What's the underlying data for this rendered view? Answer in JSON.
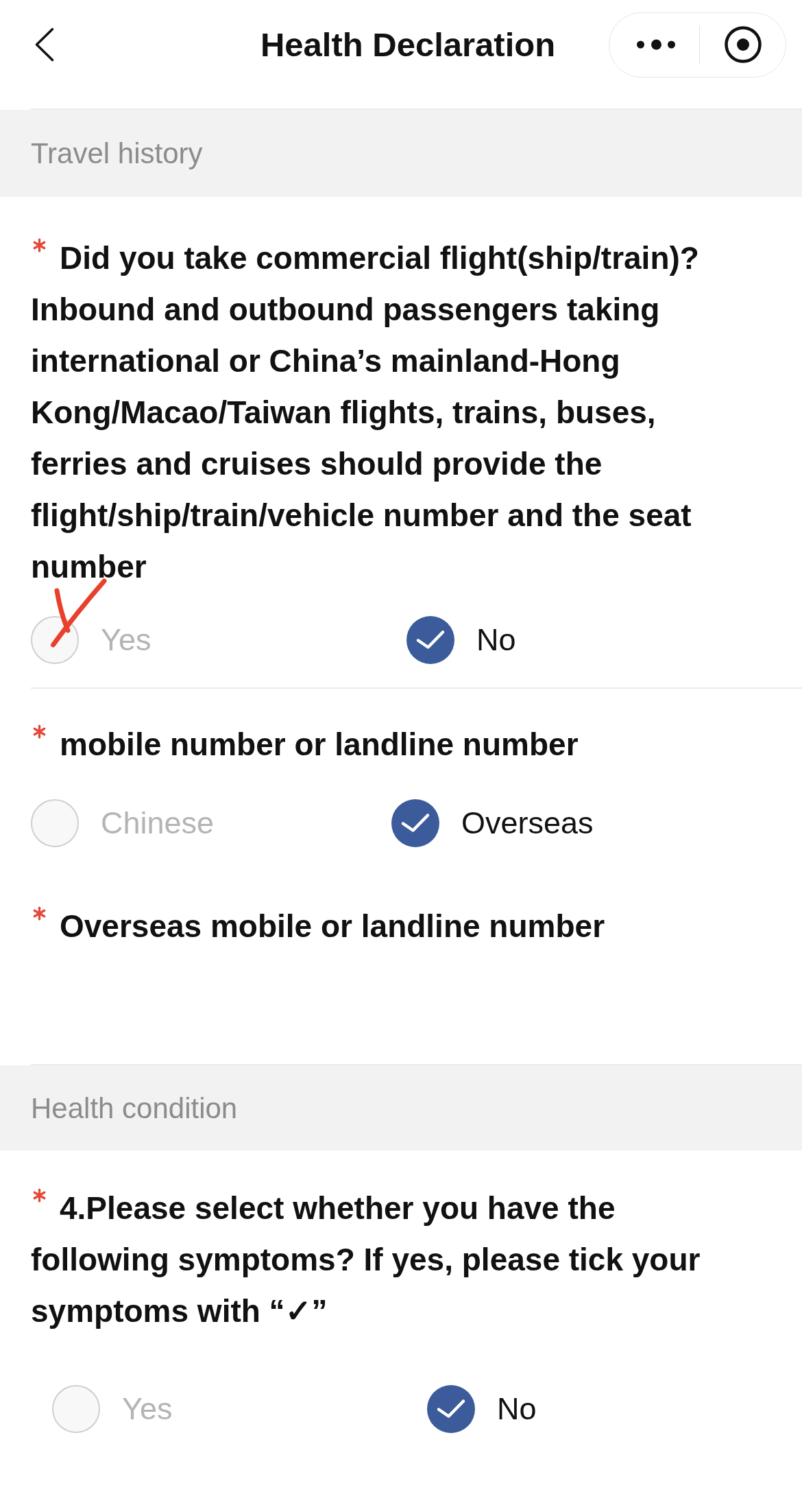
{
  "header": {
    "title": "Health Declaration"
  },
  "sections": [
    {
      "title": "Travel history",
      "questions": [
        {
          "kind": "choice",
          "required": true,
          "label": "Did you take commercial flight(ship/train)? Inbound and outbound passengers taking international or China’s mainland-Hong Kong/Macao/Taiwan flights, trains, buses, ferries and cruises should provide the flight/ship/train/vehicle number and the seat number",
          "options": [
            {
              "label": "Yes",
              "selected": false,
              "hand_ticked": true
            },
            {
              "label": "No",
              "selected": true,
              "hand_ticked": false
            }
          ]
        },
        {
          "kind": "choice",
          "required": true,
          "label": "mobile number or landline number",
          "options": [
            {
              "label": "Chinese",
              "selected": false,
              "hand_ticked": false
            },
            {
              "label": "Overseas",
              "selected": true,
              "hand_ticked": false
            }
          ]
        },
        {
          "kind": "text_input",
          "required": true,
          "label": "Overseas mobile or landline number"
        }
      ]
    },
    {
      "title": "Health condition",
      "questions": [
        {
          "kind": "choice",
          "required": true,
          "label": "4.Please select whether you have the following symptoms? If yes, please tick your symptoms with “✓”",
          "options": [
            {
              "label": "Yes",
              "selected": false,
              "hand_ticked": false
            },
            {
              "label": "No",
              "selected": true,
              "hand_ticked": false
            }
          ]
        }
      ]
    }
  ]
}
